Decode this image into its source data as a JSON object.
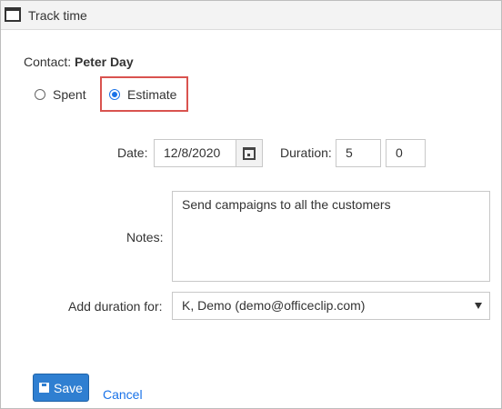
{
  "window": {
    "title": "Track time"
  },
  "contact": {
    "label": "Contact:",
    "name": "Peter Day"
  },
  "time_type": {
    "options": [
      {
        "label": "Spent",
        "selected": false
      },
      {
        "label": "Estimate",
        "selected": true
      }
    ],
    "highlight_color": "#d9534f"
  },
  "date": {
    "label": "Date:",
    "value": "12/8/2020"
  },
  "duration": {
    "label": "Duration:",
    "hours": "5",
    "minutes": "0"
  },
  "notes": {
    "label": "Notes:",
    "value": "Send campaigns to all the customers"
  },
  "add_duration": {
    "label": "Add duration for:",
    "selected": "K, Demo (demo@officeclip.com)"
  },
  "actions": {
    "save_label": "Save",
    "cancel_label": "Cancel"
  },
  "colors": {
    "accent": "#2f7fd1",
    "link": "#1a73e8"
  }
}
